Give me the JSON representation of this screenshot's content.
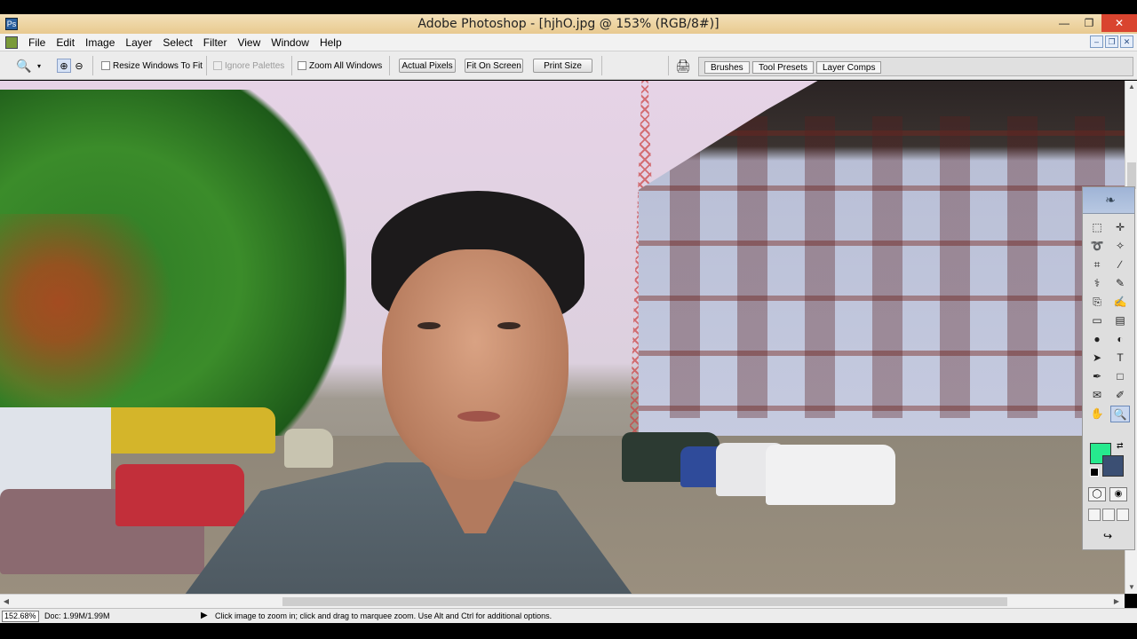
{
  "window": {
    "title": "Adobe Photoshop - [hjhO.jpg @ 153% (RGB/8#)]",
    "controls": [
      "—",
      "❐",
      "✕"
    ]
  },
  "menu": {
    "items": [
      "File",
      "Edit",
      "Image",
      "Layer",
      "Select",
      "Filter",
      "View",
      "Window",
      "Help"
    ],
    "doc_controls": [
      "–",
      "❐",
      "✕"
    ]
  },
  "options": {
    "resize_windows": "Resize Windows To Fit",
    "ignore_palettes": "Ignore Palettes",
    "zoom_all": "Zoom All Windows",
    "actual_pixels": "Actual Pixels",
    "fit_on_screen": "Fit On Screen",
    "print_size": "Print Size",
    "zoom_in_glyph": "⊕",
    "zoom_out_glyph": "⊖",
    "zoom_tool_glyph": "🔍",
    "dropdown_glyph": "▾",
    "print_glyph": "🖨"
  },
  "palette_well": {
    "tabs": [
      "Brushes",
      "Tool Presets",
      "Layer Comps"
    ]
  },
  "status": {
    "zoom": "152.68%",
    "doc": "Doc: 1.99M/1.99M",
    "arrow": "▶",
    "hint": "Click image to zoom in; click and drag to marquee zoom.  Use Alt and Ctrl for additional options."
  },
  "scroll": {
    "up": "▲",
    "down": "▼",
    "left": "◀",
    "right": "▶"
  },
  "colors": {
    "foreground": "#26ea8e",
    "background": "#3b4f73"
  },
  "tools": [
    {
      "name": "rectangular-marquee-icon",
      "glyph": "⬚"
    },
    {
      "name": "move-icon",
      "glyph": "✛"
    },
    {
      "name": "lasso-icon",
      "glyph": "➰"
    },
    {
      "name": "magic-wand-icon",
      "glyph": "✧"
    },
    {
      "name": "crop-icon",
      "glyph": "⌗"
    },
    {
      "name": "slice-icon",
      "glyph": "∕"
    },
    {
      "name": "healing-brush-icon",
      "glyph": "⚕"
    },
    {
      "name": "brush-icon",
      "glyph": "✎"
    },
    {
      "name": "clone-stamp-icon",
      "glyph": "⎘"
    },
    {
      "name": "history-brush-icon",
      "glyph": "✍"
    },
    {
      "name": "eraser-icon",
      "glyph": "▭"
    },
    {
      "name": "gradient-icon",
      "glyph": "▤"
    },
    {
      "name": "blur-icon",
      "glyph": "●"
    },
    {
      "name": "dodge-icon",
      "glyph": "◐"
    },
    {
      "name": "path-selection-icon",
      "glyph": "➤"
    },
    {
      "name": "type-icon",
      "glyph": "T"
    },
    {
      "name": "pen-icon",
      "glyph": "✒"
    },
    {
      "name": "shape-icon",
      "glyph": "□"
    },
    {
      "name": "notes-icon",
      "glyph": "✉"
    },
    {
      "name": "eyedropper-icon",
      "glyph": "✐"
    },
    {
      "name": "hand-icon",
      "glyph": "✋"
    },
    {
      "name": "zoom-icon",
      "glyph": "🔍"
    }
  ]
}
